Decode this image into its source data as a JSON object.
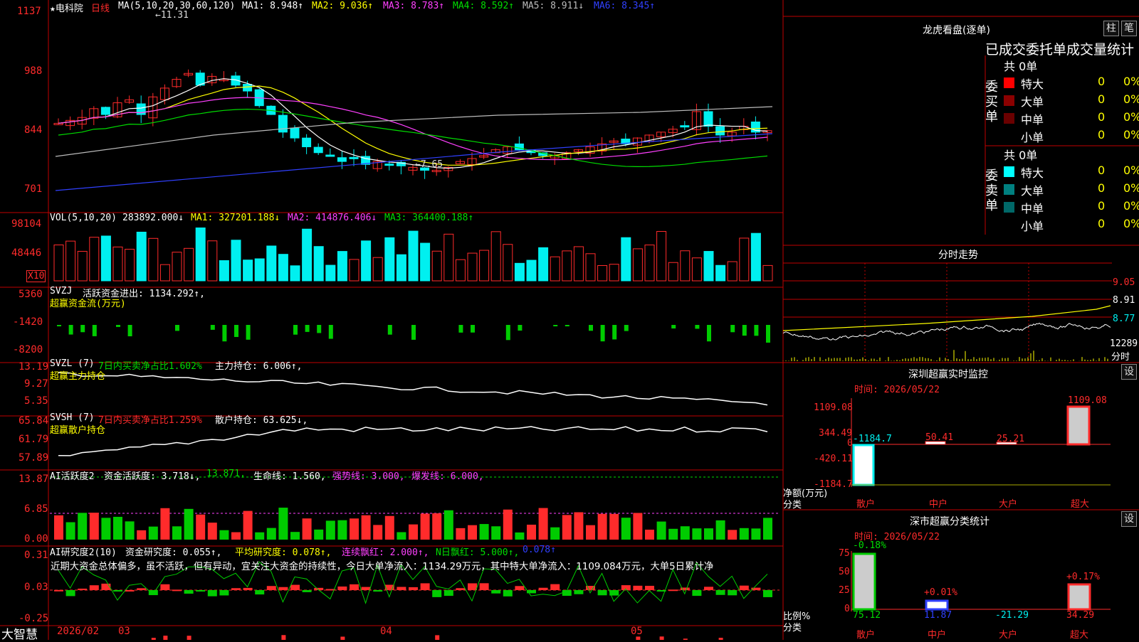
{
  "colors": {
    "up": "#ff2b2b",
    "down": "#00f0f0",
    "green": "#00dd00",
    "frame": "#c00000",
    "yellow": "#ffff00",
    "magenta": "#ff40ff",
    "white": "#ffffff",
    "grey": "#bbbbbb",
    "blue": "#3040ff",
    "vgreen": "#00cc00"
  },
  "stock": {
    "name": "★电科院",
    "period": "日线"
  },
  "ma_header": {
    "prefix": "MA(5,10,20,30,60,120)",
    "items": [
      {
        "label": "MA1: 8.948↑",
        "color": "#ffffff"
      },
      {
        "label": "MA2: 9.036↑",
        "color": "#ffff00"
      },
      {
        "label": "MA3: 8.783↑",
        "color": "#ff40ff"
      },
      {
        "label": "MA4: 8.592↑",
        "color": "#00dd00"
      },
      {
        "label": "MA5: 8.911↓",
        "color": "#bbbbbb"
      },
      {
        "label": "MA6: 8.345↑",
        "color": "#3040ff"
      }
    ]
  },
  "price_axis": [
    "1137",
    "988",
    "844",
    "701"
  ],
  "price_marks": {
    "high": "←11.31",
    "low": "←7.65"
  },
  "vol": {
    "header": "VOL(5,10,20)",
    "value": "283892.000↓",
    "ma1": "MA1: 327201.188↓",
    "ma2": "MA2: 414876.406↓",
    "ma3": "MA3: 364400.188↑",
    "axis": [
      "98104",
      "48446"
    ],
    "unit": "X10"
  },
  "svzj": {
    "title": "SVZJ",
    "active": "活跃资金进出: 1134.292↑,",
    "subtitle": "超赢资金流(万元)",
    "axis": [
      "5360",
      "-1420",
      "-8200"
    ]
  },
  "svzl": {
    "title": "SVZL (7)",
    "ratio": "7日内买卖净占比1.602%",
    "hold": "主力持仓: 6.006↑,",
    "subtitle": "超赢主力持仓",
    "axis": [
      "13.19",
      "9.27",
      "5.35"
    ]
  },
  "svsh": {
    "title": "SVSH (7)",
    "ratio": "7日内买卖净占比1.259%",
    "hold": "散户持仓: 63.625↓,",
    "subtitle": "超赢散户持仓",
    "axis": [
      "65.84",
      "61.79",
      "57.89"
    ]
  },
  "ai_active": {
    "title": "AI活跃度2",
    "v1": "资金活跃度: 3.718↓,",
    "v2": "13.871,",
    "v3": "生命线: 1.560,",
    "v4": "强势线: 3.000,",
    "v5": "爆发线: 6.000,",
    "axis": [
      "13.87",
      "6.85",
      "0.00"
    ]
  },
  "ai_research": {
    "title": "AI研究度2(10)",
    "v1": "资金研究度: 0.055↑,",
    "v2": "平均研究度: 0.078↑,",
    "v3": "连续飘红: 2.000↑,",
    "v4": "N日飘红: 5.000↑,",
    "v5": "0.078↑",
    "comment": "近期大资金总体偏多，虽不活跃，但有异动，宜关注大资金的持续性，今日大单净流入：1134.29万元，其中特大单净流入：1109.084万元，大单5日累计净",
    "axis": [
      "0.31",
      "0.03",
      "-0.25"
    ]
  },
  "bottom": {
    "logo": "大智慧",
    "dates": [
      "2026/02",
      "03",
      "04",
      "05"
    ]
  },
  "dragon": {
    "title": "龙虎看盘(逐单)",
    "btn1": "柱",
    "btn2": "笔",
    "subtitle": "已成交委托单成交量统计",
    "buy_label": "委买单",
    "sell_label": "委卖单",
    "buy_total": "共 0单",
    "sell_total": "共 0单",
    "buy_rows": [
      {
        "name": "特大",
        "count": "0",
        "pct": "0%",
        "color": "#ff0000"
      },
      {
        "name": "大单",
        "count": "0",
        "pct": "0%",
        "color": "#8b0000"
      },
      {
        "name": "中单",
        "count": "0",
        "pct": "0%",
        "color": "#6a0000"
      },
      {
        "name": "小单",
        "count": "0",
        "pct": "0%",
        "color": "#000000"
      }
    ],
    "sell_rows": [
      {
        "name": "特大",
        "count": "0",
        "pct": "0%",
        "color": "#00ffff"
      },
      {
        "name": "大单",
        "count": "0",
        "pct": "0%",
        "color": "#008080"
      },
      {
        "name": "中单",
        "count": "0",
        "pct": "0%",
        "color": "#006868"
      },
      {
        "name": "小单",
        "count": "0",
        "pct": "0%",
        "color": "#000000"
      }
    ]
  },
  "intraday": {
    "title": "分时走势",
    "axis": [
      "9.05",
      "8.91",
      "8.77"
    ],
    "vol_label": "12289",
    "vol_unit": "分时"
  },
  "sz_monitor": {
    "title": "深圳超赢实时监控",
    "btn": "设",
    "time": "时间: 2026/05/22",
    "axis": [
      "1109.08",
      "344.49",
      "0",
      "-420.11",
      "-1184.7"
    ],
    "ylabel": "净额(万元)",
    "xlabel": "分类",
    "categories": [
      "散户",
      "中户",
      "大户",
      "超大"
    ],
    "values": [
      "-1184.7",
      "50.41",
      "25.21",
      "1109.08"
    ]
  },
  "sz_class": {
    "title": "深市超赢分类统计",
    "btn": "设",
    "time": "时间: 2026/05/22",
    "axis": [
      "75",
      "50",
      "25",
      "0"
    ],
    "ylabel": "比例%",
    "xlabel": "分类",
    "categories": [
      "散户",
      "中户",
      "大户",
      "超大"
    ],
    "bottom_values": [
      "75.12",
      "11.87",
      "-21.29",
      "34.29"
    ],
    "top_values": [
      "-0.18%",
      "+0.01%",
      "",
      "+0.17%"
    ]
  }
}
